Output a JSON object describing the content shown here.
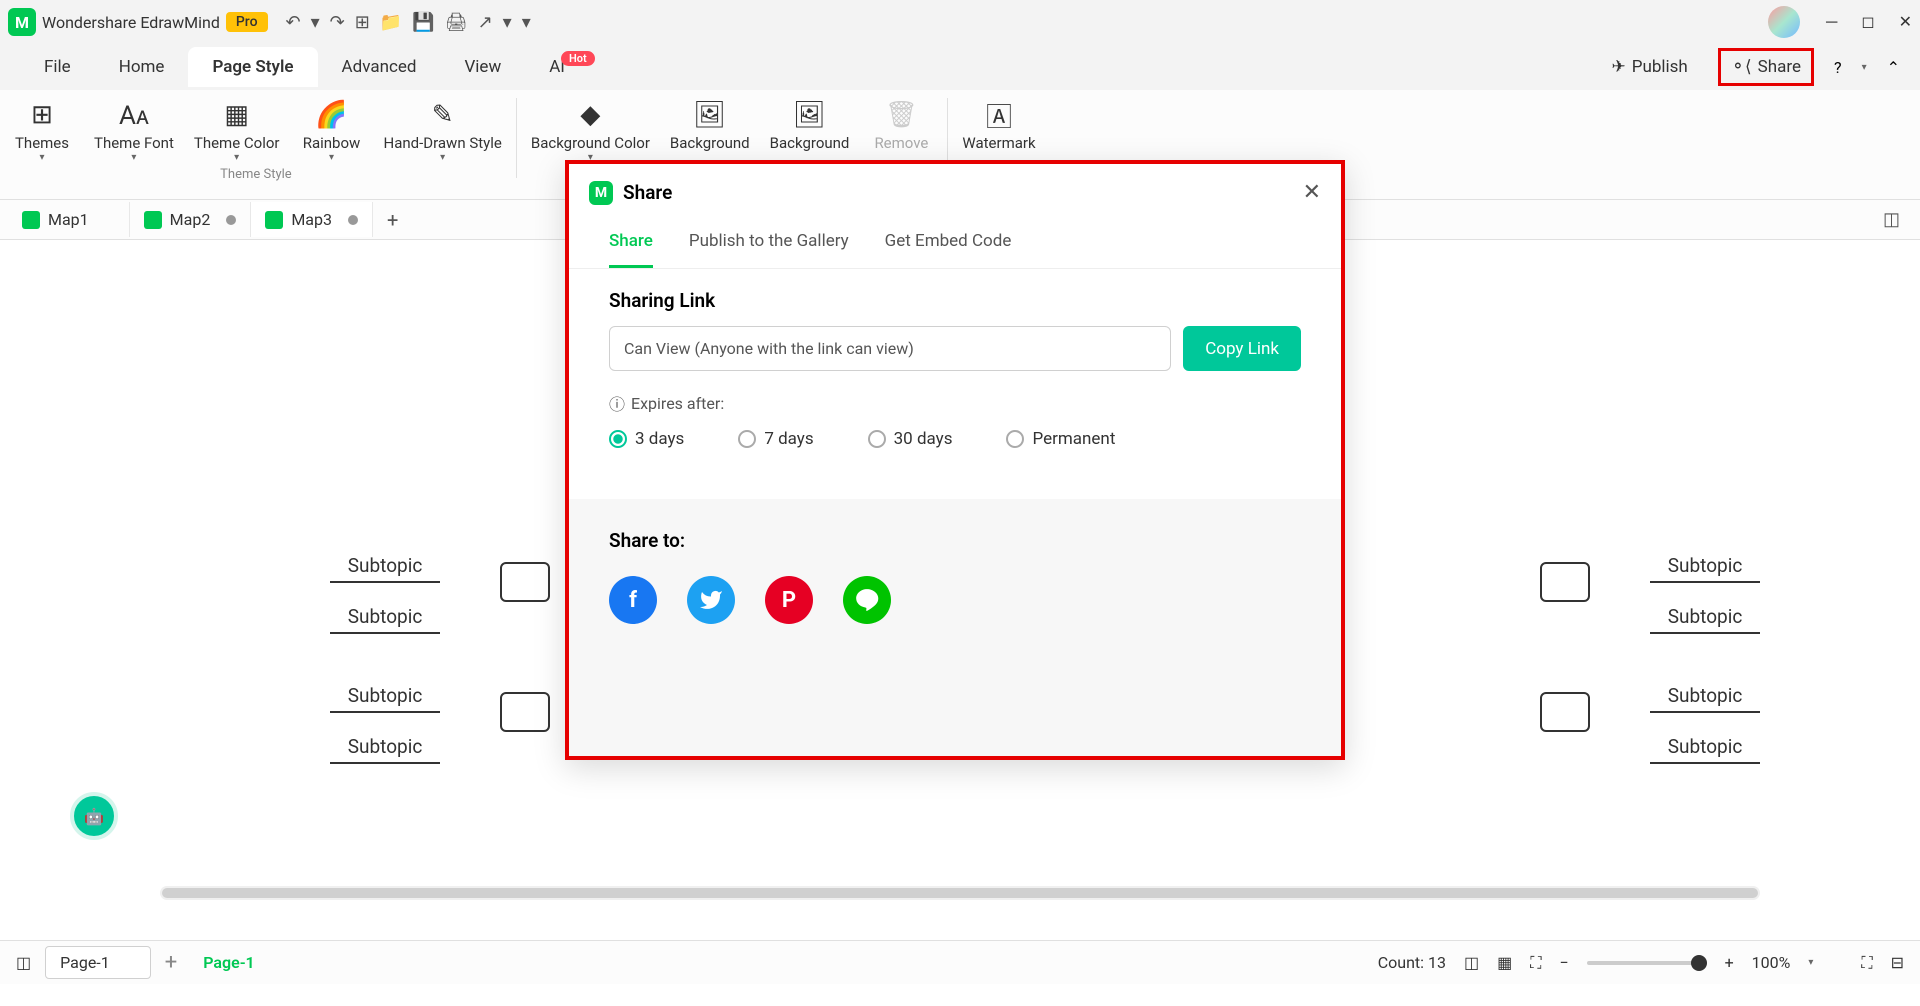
{
  "titlebar": {
    "app": "Wondershare EdrawMind",
    "pro": "Pro"
  },
  "menubar": {
    "file": "File",
    "home": "Home",
    "pageStyle": "Page Style",
    "advanced": "Advanced",
    "view": "View",
    "ai": "AI",
    "hot": "Hot",
    "publish": "Publish",
    "share": "Share"
  },
  "ribbon": {
    "themes": "Themes",
    "themeFont": "Theme\nFont",
    "themeColor": "Theme\nColor",
    "rainbow": "Rainbow",
    "handDrawn": "Hand-Drawn\nStyle",
    "group1": "Theme Style",
    "bgColor": "Background\nColor",
    "bg1": "Background",
    "bg2": "Background",
    "remove": "Remove",
    "watermark": "Watermark"
  },
  "tabs": {
    "map1": "Map1",
    "map2": "Map2",
    "map3": "Map3"
  },
  "canvas": {
    "subtopic": "Subtopic"
  },
  "dialog": {
    "title": "Share",
    "tabs": {
      "share": "Share",
      "gallery": "Publish to the Gallery",
      "embed": "Get Embed Code"
    },
    "sharingLink": "Sharing Link",
    "linkValue": "Can View (Anyone with the link can view)",
    "copyLink": "Copy Link",
    "expires": "Expires after:",
    "opt3": "3 days",
    "opt7": "7 days",
    "opt30": "30 days",
    "optPerm": "Permanent",
    "shareTo": "Share to:"
  },
  "statusbar": {
    "page1": "Page-1",
    "pageActive": "Page-1",
    "count": "Count: 13",
    "zoom": "100%"
  }
}
